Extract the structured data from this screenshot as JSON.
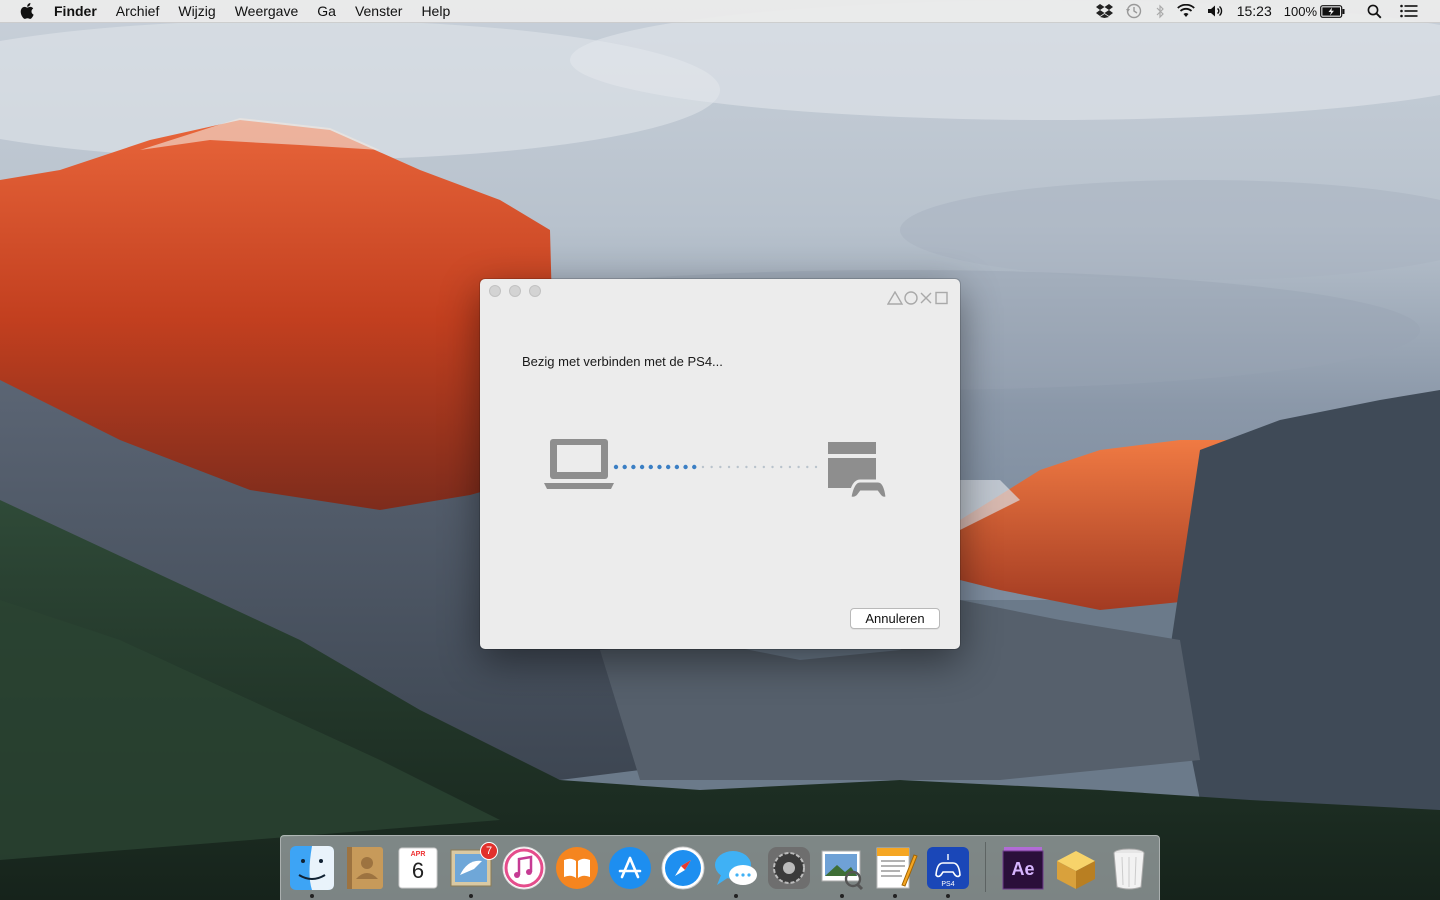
{
  "menubar": {
    "app_name": "Finder",
    "menus": [
      "Archief",
      "Wijzig",
      "Weergave",
      "Ga",
      "Venster",
      "Help"
    ],
    "clock": "15:23",
    "battery": "100%",
    "status_icons": [
      "dropbox-icon",
      "time-machine-icon",
      "bluetooth-icon",
      "wifi-icon",
      "volume-icon",
      "battery-icon",
      "spotlight-icon",
      "notification-center-icon"
    ]
  },
  "dialog": {
    "status": "Bezig met verbinden met de PS4...",
    "cancel_label": "Annuleren",
    "progress_dots_active": 10,
    "progress_dots_total": 24
  },
  "dock": {
    "items": [
      {
        "name": "finder",
        "running": true
      },
      {
        "name": "contacts",
        "running": false
      },
      {
        "name": "calendar",
        "running": false,
        "month": "APR",
        "day": "6"
      },
      {
        "name": "mail",
        "running": true,
        "badge": "7"
      },
      {
        "name": "itunes",
        "running": false
      },
      {
        "name": "ibooks",
        "running": false
      },
      {
        "name": "app-store",
        "running": false
      },
      {
        "name": "safari",
        "running": false
      },
      {
        "name": "messages",
        "running": true
      },
      {
        "name": "system-preferences",
        "running": false
      },
      {
        "name": "preview",
        "running": true
      },
      {
        "name": "pages",
        "running": true
      },
      {
        "name": "ps4-remote-play",
        "running": true,
        "label": "PS4"
      },
      {
        "name": "after-effects",
        "running": false,
        "label": "Ae"
      },
      {
        "name": "archive",
        "running": false
      },
      {
        "name": "trash",
        "running": false
      }
    ]
  },
  "colors": {
    "progress_active": "#3b7fc4",
    "progress_inactive": "#b9c3cc",
    "device_gray": "#8e8e8e"
  }
}
